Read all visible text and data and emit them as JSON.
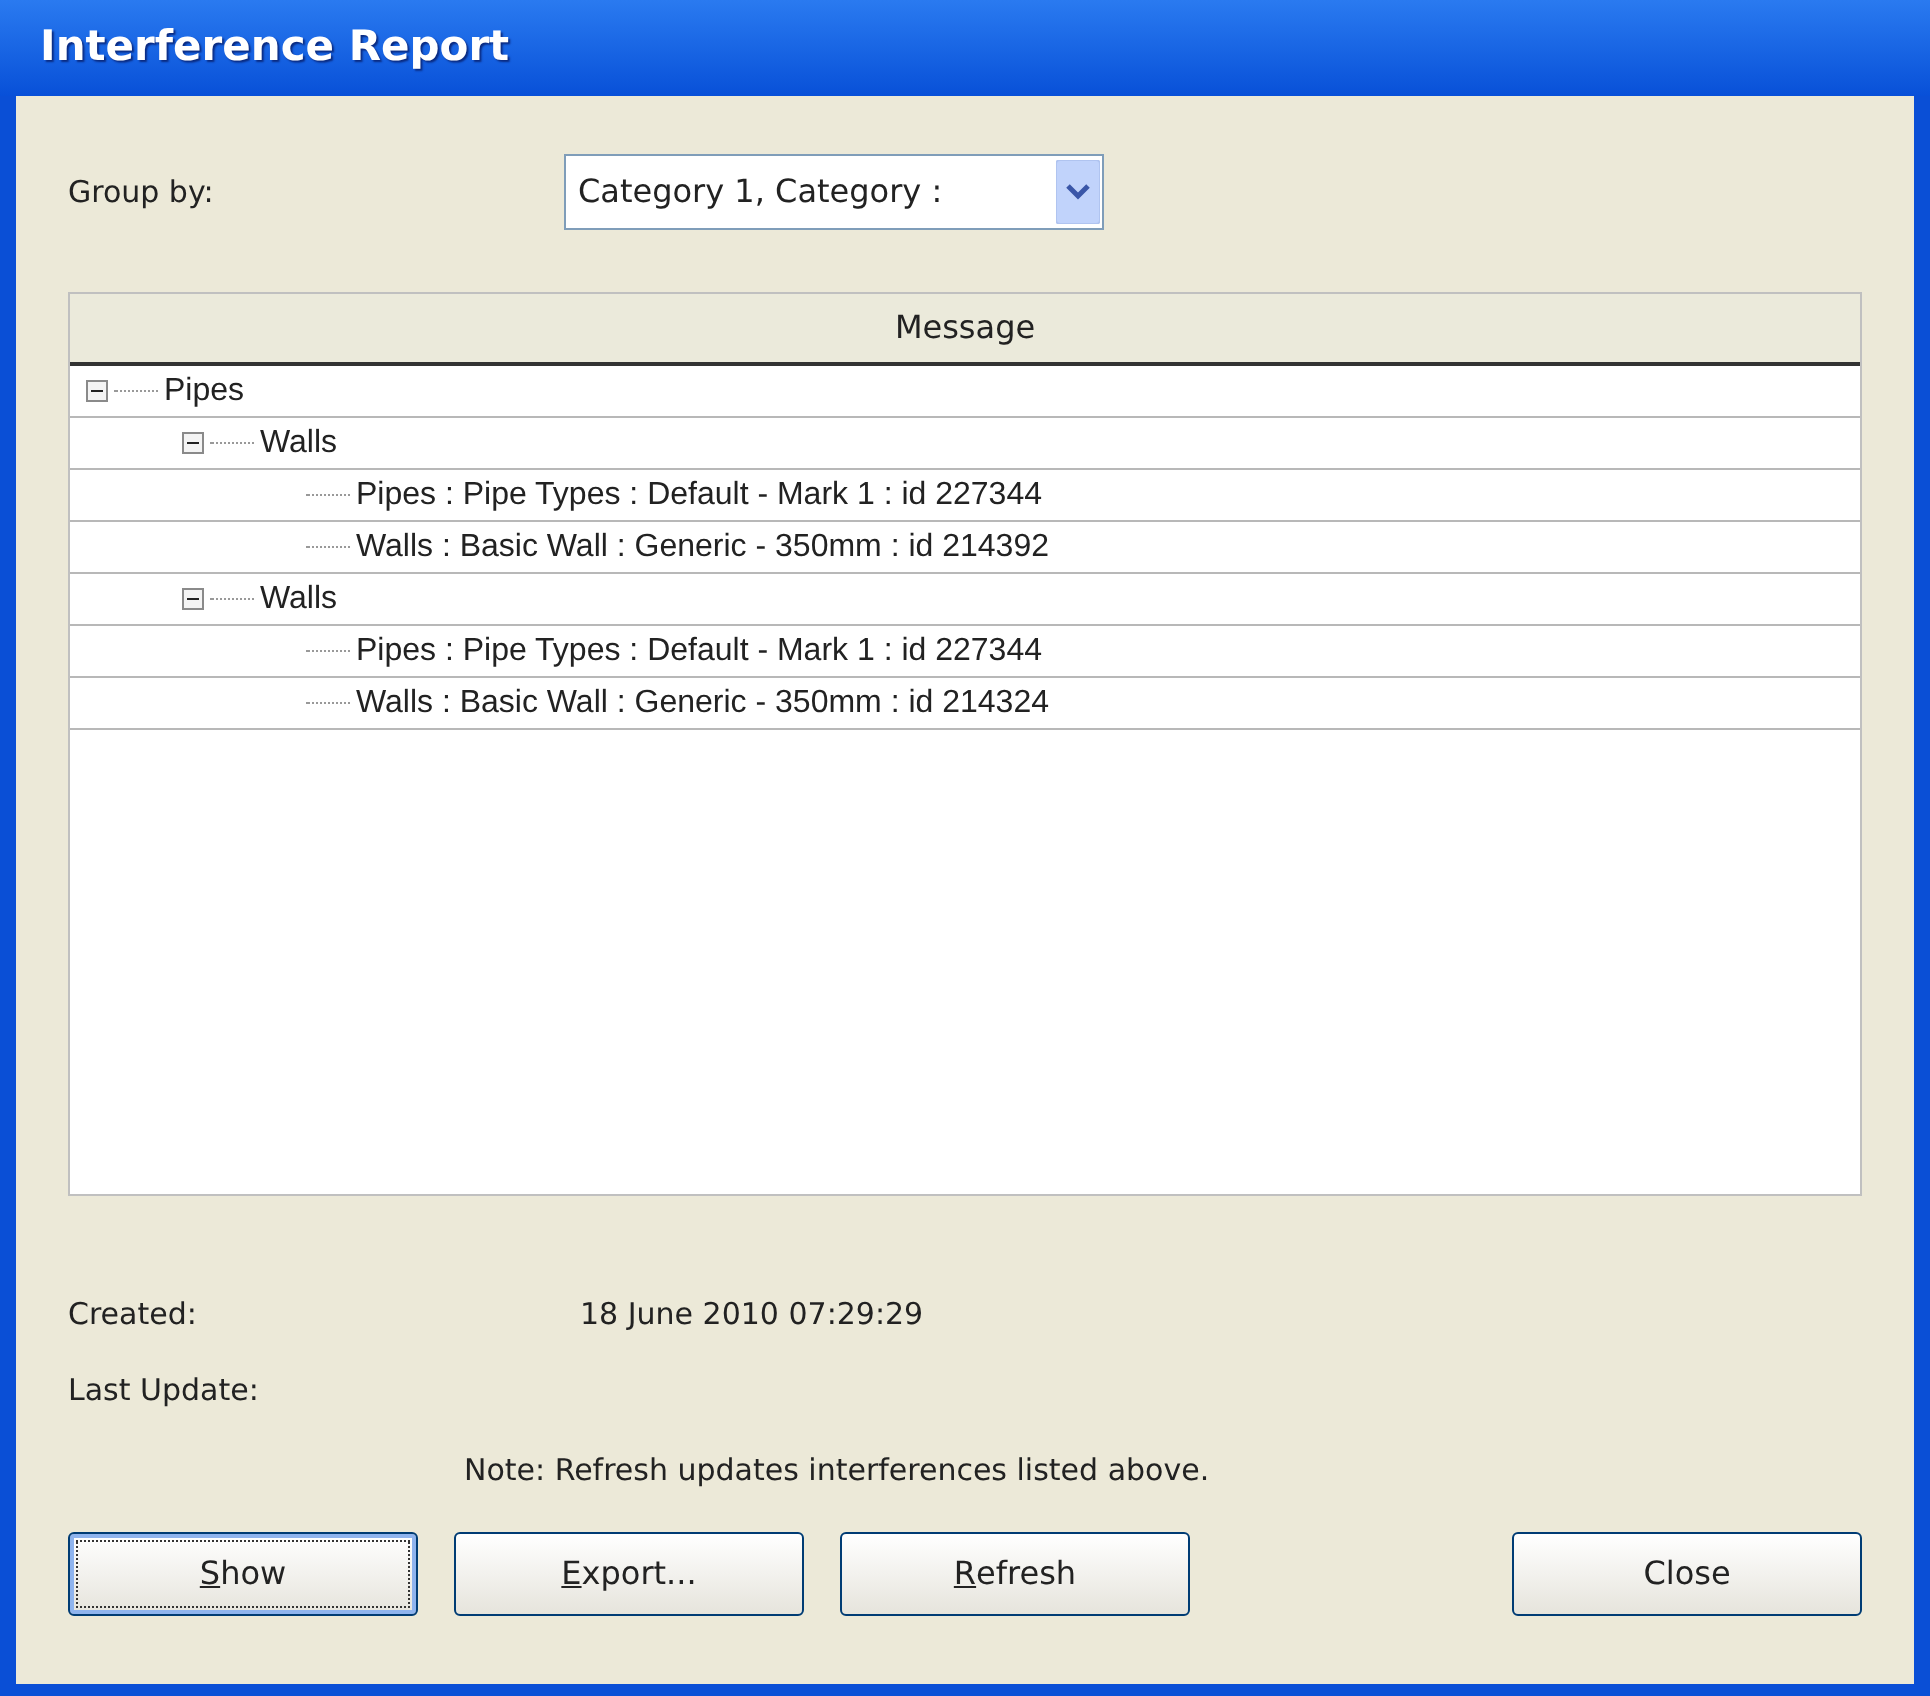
{
  "window": {
    "title": "Interference Report"
  },
  "group_by": {
    "label": "Group by:",
    "value": "Category 1, Category :"
  },
  "tree": {
    "column": "Message",
    "items": [
      {
        "label": "Pipes",
        "expanded": true,
        "children": [
          {
            "label": "Walls",
            "expanded": true,
            "children": [
              {
                "label": "Pipes : Pipe Types : Default - Mark 1 : id 227344"
              },
              {
                "label": "Walls : Basic Wall : Generic - 350mm : id 214392"
              }
            ]
          },
          {
            "label": "Walls",
            "expanded": true,
            "children": [
              {
                "label": "Pipes : Pipe Types : Default - Mark 1 : id 227344"
              },
              {
                "label": "Walls : Basic Wall : Generic - 350mm : id 214324"
              }
            ]
          }
        ]
      }
    ]
  },
  "created": {
    "label": "Created:",
    "value": "18 June 2010 07:29:29"
  },
  "last_update": {
    "label": "Last Update:"
  },
  "note": "Note: Refresh updates interferences listed above.",
  "buttons": [
    {
      "label": "Show",
      "first_letter_underlined": true,
      "focused": true
    },
    {
      "label": "Export...",
      "first_letter_underlined": true,
      "focused": false
    },
    {
      "label": "Refresh",
      "first_letter_underlined": true,
      "focused": false
    },
    {
      "label": "Close",
      "first_letter_underlined": false,
      "focused": false
    }
  ]
}
